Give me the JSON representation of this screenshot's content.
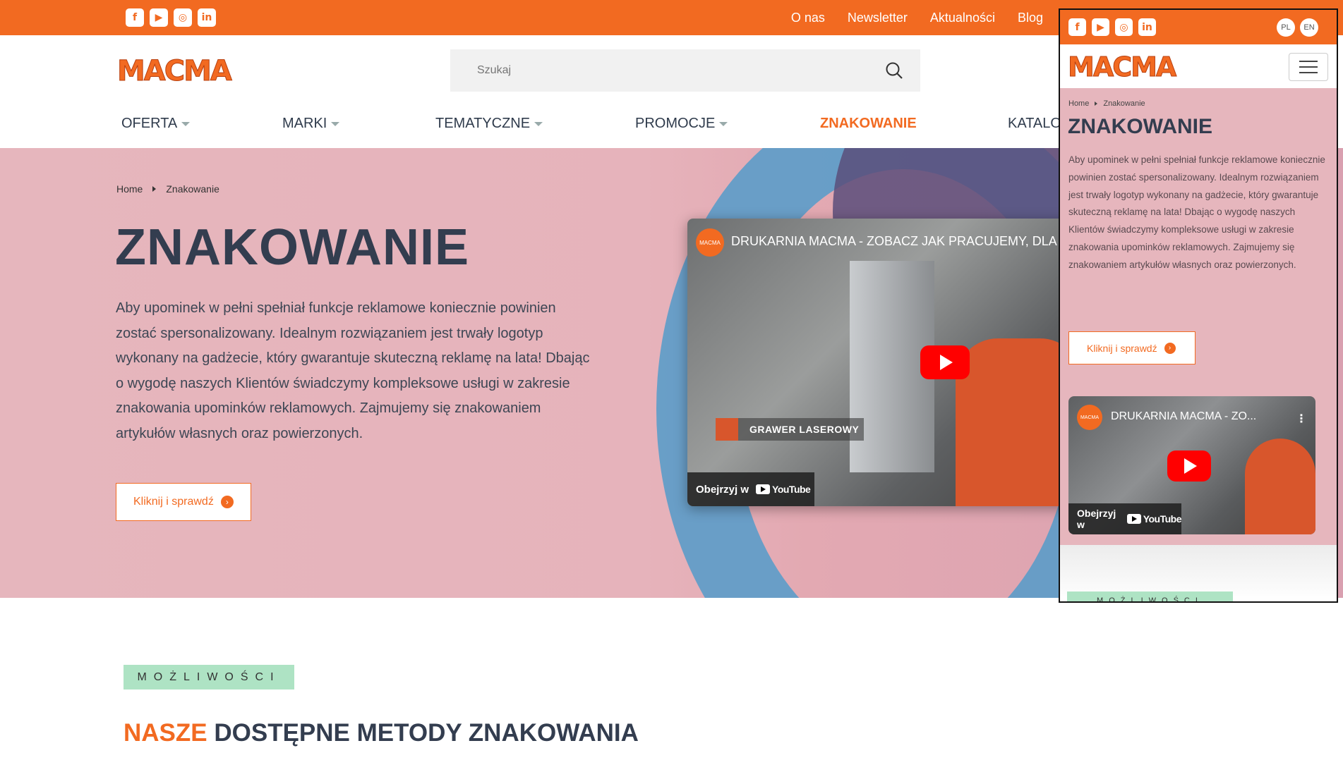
{
  "social": [
    "f",
    "▶",
    "◎",
    "in"
  ],
  "topnav": [
    "O nas",
    "Newsletter",
    "Aktualności",
    "Blog"
  ],
  "logo_text": "MACMA",
  "search": {
    "placeholder": "Szukaj"
  },
  "mainnav": {
    "items": [
      "OFERTA",
      "MARKI",
      "TEMATYCZNE",
      "PROMOCJE",
      "ZNAKOWANIE",
      "KATALO"
    ]
  },
  "breadcrumb": {
    "home": "Home",
    "current": "Znakowanie"
  },
  "hero": {
    "title": "ZNAKOWANIE",
    "lead": "Aby upominek w pełni spełniał funkcje reklamowe koniecznie powinien zostać spersonalizowany. Idealnym rozwiązaniem jest trwały logotyp wykonany na gadżecie, który gwarantuje skuteczną reklamę na lata! Dbając o wygodę naszych Klientów świadczymy kompleksowe usługi w zakresie znakowania upominków reklamowych. Zajmujemy się znakowaniem artykułów własnych oraz powierzonych.",
    "button": "Kliknij i sprawdź"
  },
  "video": {
    "channel": "MACMA",
    "title": "DRUKARNIA MACMA - ZOBACZ JAK PRACUJEMY, DLA CIE",
    "caption": "GRAWER LASEROWY",
    "watch": "Obejrzyj w",
    "youtube": "YouTube"
  },
  "section": {
    "tag": "MOŻLIWOŚCI",
    "title_highlight": "NASZE",
    "title_rest": " DOSTĘPNE METODY ZNAKOWANIA"
  },
  "mobile": {
    "lang_pl": "PL",
    "lang_en": "EN",
    "video_title": "DRUKARNIA MACMA - ZO...",
    "tag": "MOŻLIWOŚCI"
  },
  "colors": {
    "accent": "#f26a21",
    "hero_bg": "#e6b6bd",
    "tag_bg": "#aee3c4"
  }
}
